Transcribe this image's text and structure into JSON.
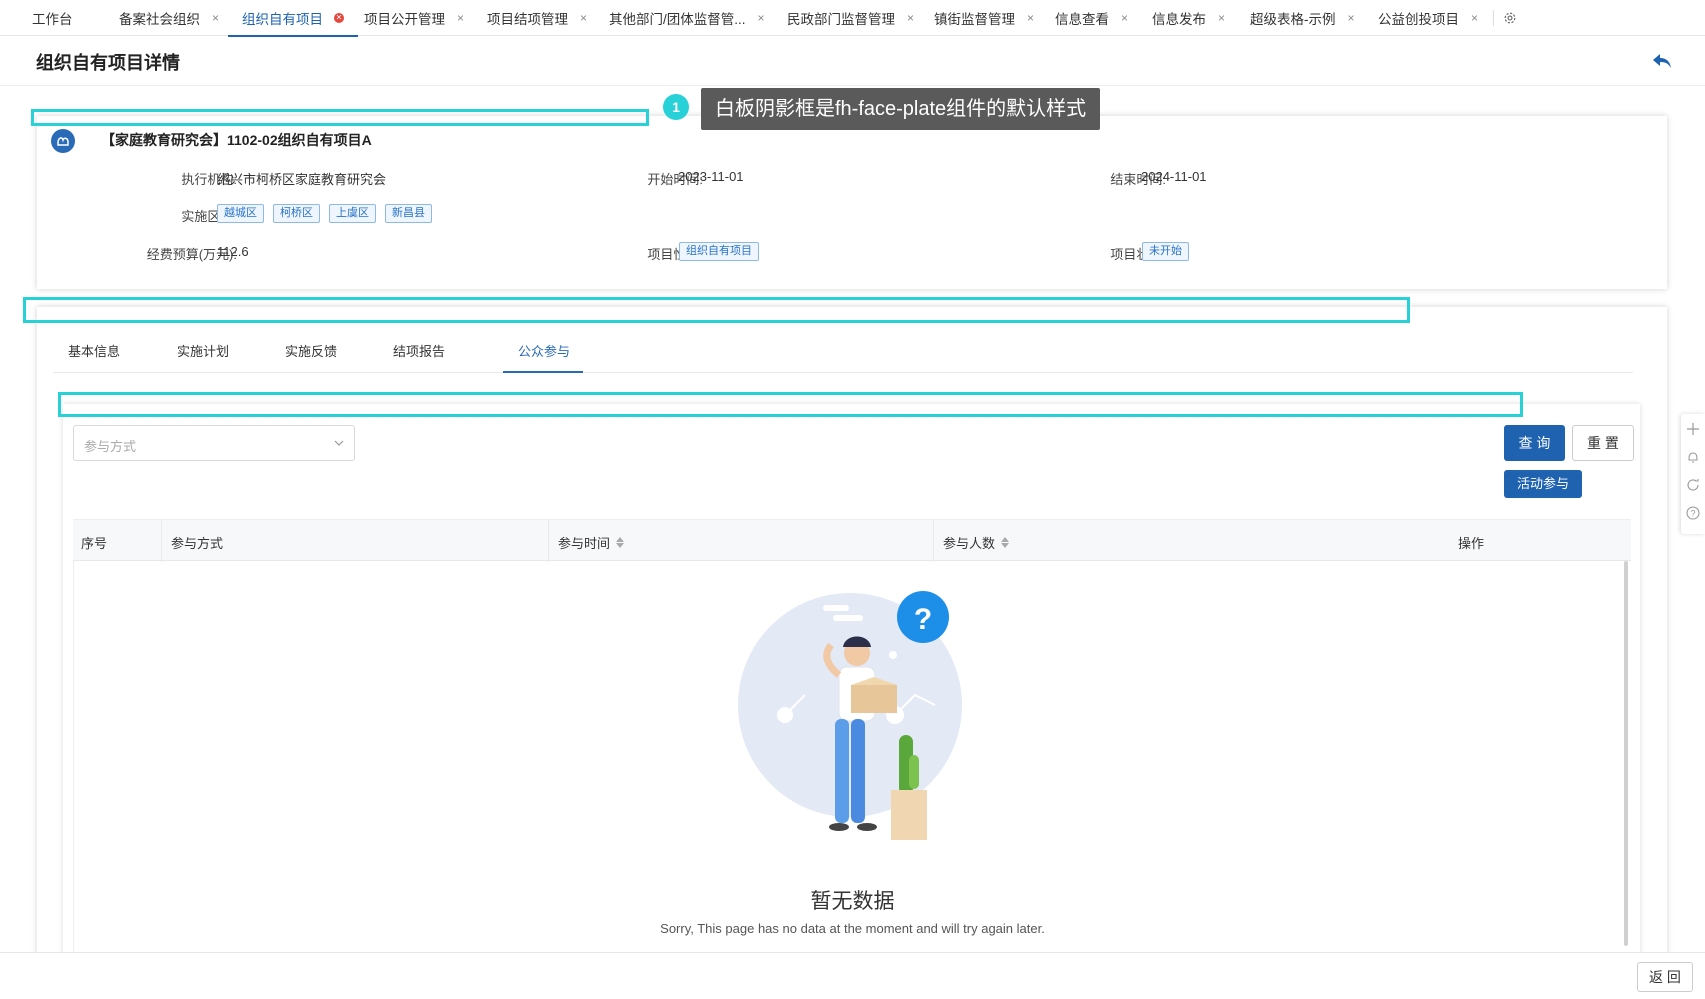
{
  "tabs": [
    {
      "label": "工作台",
      "closable": false
    },
    {
      "label": "备案社会组织",
      "closable": true
    },
    {
      "label": "组织自有项目",
      "closable": true,
      "active": true
    },
    {
      "label": "项目公开管理",
      "closable": true
    },
    {
      "label": "项目结项管理",
      "closable": true
    },
    {
      "label": "其他部门/团体监督管...",
      "closable": true
    },
    {
      "label": "民政部门监督管理",
      "closable": true
    },
    {
      "label": "镇街监督管理",
      "closable": true
    },
    {
      "label": "信息查看",
      "closable": true
    },
    {
      "label": "信息发布",
      "closable": true
    },
    {
      "label": "超级表格-示例",
      "closable": true
    },
    {
      "label": "公益创投项目",
      "closable": true
    }
  ],
  "close_glyph": "×",
  "page": {
    "title": "组织自有项目详情"
  },
  "annotation": {
    "number": "1",
    "text": "白板阴影框是fh-face-plate组件的默认样式"
  },
  "project": {
    "title": "【家庭教育研究会】1102-02组织自有项目A",
    "exec_org_label": "执行机构:",
    "exec_org_value": "绍兴市柯桥区家庭教育研究会",
    "start_label": "开始时间:",
    "start_value": "2023-11-01",
    "end_label": "结束时间:",
    "end_value": "2024-11-01",
    "area_label": "实施区域:",
    "areas": [
      "越城区",
      "柯桥区",
      "上虞区",
      "新昌县"
    ],
    "budget_label": "经费预算(万元):",
    "budget_value": "112.6",
    "nature_label": "项目性质:",
    "nature_value": "组织自有项目",
    "status_label": "项目状态:",
    "status_value": "未开始"
  },
  "subtabs": [
    "基本信息",
    "实施计划",
    "实施反馈",
    "结项报告",
    "公众参与"
  ],
  "active_subtab": "公众参与",
  "filter": {
    "participation_placeholder": "参与方式",
    "query_label": "查 询",
    "reset_label": "重 置",
    "activity_label": "活动参与"
  },
  "table": {
    "columns": [
      "序号",
      "参与方式",
      "参与时间",
      "参与人数",
      "操作"
    ],
    "rows": []
  },
  "empty": {
    "title": "暂无数据",
    "subtitle": "Sorry, This page has no data at the moment and will try again later."
  },
  "footer": {
    "back_label": "返 回"
  },
  "colors": {
    "primary": "#1e62b0",
    "annotation": "#28d0d8",
    "tag_border": "#8fb8e6"
  }
}
